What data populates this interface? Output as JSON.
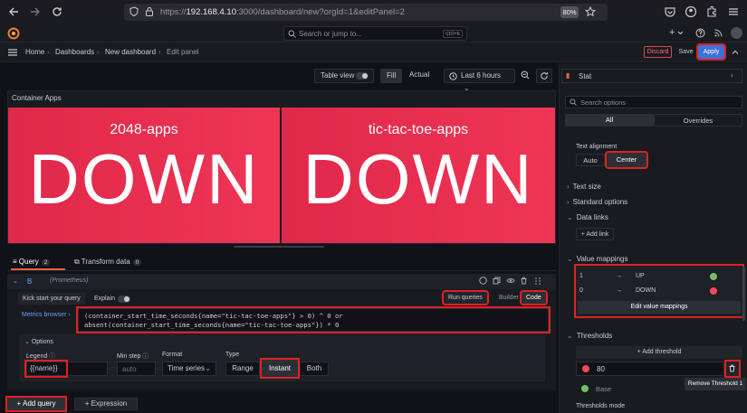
{
  "browser": {
    "url_prefix": "https://",
    "url_host": "192.168.4.10",
    "url_rest": ":3000/dashboard/new?orgId=1&editPanel=2",
    "zoom": "80%"
  },
  "topbar": {
    "search_placeholder": "Search or jump to...",
    "search_shortcut": "ctrl+k",
    "plus": "+"
  },
  "breadcrumb": {
    "items": [
      "Home",
      "Dashboards",
      "New dashboard",
      "Edit panel"
    ],
    "discard": "Discard",
    "save": "Save",
    "apply": "Apply"
  },
  "toolbar": {
    "table_view": "Table view",
    "fill": "Fill",
    "actual": "Actual",
    "time_range": "Last 6 hours"
  },
  "panel": {
    "title": "Container Apps",
    "stats": [
      {
        "name": "2048-apps",
        "value": "DOWN"
      },
      {
        "name": "tic-tac-toe-apps",
        "value": "DOWN"
      }
    ]
  },
  "query": {
    "tab_query": "Query",
    "tab_query_count": "2",
    "tab_transform": "Transform data",
    "tab_transform_count": "0",
    "ref_id": "B",
    "datasource": "(Prometheus)",
    "kick_start": "Kick start your query",
    "explain": "Explain",
    "run_queries": "Run queries",
    "builder": "Builder",
    "code": "Code",
    "metrics_browser": "Metrics browser",
    "expression": "(container_start_time_seconds{name=\"tic-tac-toe-apps\"} > 0) ^ 0 or absent(container_start_time_seconds{name=\"tic-tac-toe-apps\"}) * 0",
    "options_label": "Options",
    "legend_label": "Legend",
    "legend_value": "{{name}}",
    "min_step_label": "Min step",
    "min_step_placeholder": "auto",
    "format_label": "Format",
    "format_value": "Time series",
    "type_label": "Type",
    "type_range": "Range",
    "type_instant": "Instant",
    "type_both": "Both",
    "add_query": "Add query",
    "expression_btn": "Expression"
  },
  "options": {
    "viz_name": "Stat",
    "search_placeholder": "Search options",
    "tab_all": "All",
    "tab_overrides": "Overrides",
    "text_alignment_label": "Text alignment",
    "align_auto": "Auto",
    "align_center": "Center",
    "text_size": "Text size",
    "standard_options": "Standard options",
    "data_links": "Data links",
    "add_link": "Add link",
    "value_mappings": "Value mappings",
    "mappings": [
      {
        "value": "1",
        "arrow": "→",
        "text": "UP",
        "color": "#73bf69"
      },
      {
        "value": "0",
        "arrow": "→",
        "text": "DOWN",
        "color": "#f2495c"
      }
    ],
    "edit_value_mappings": "Edit value mappings",
    "thresholds": "Thresholds",
    "add_threshold": "Add threshold",
    "threshold_value": "80",
    "threshold_color": "#f2495c",
    "base_label": "Base",
    "base_color": "#73bf69",
    "remove_threshold_tooltip": "Remove Threshold 1",
    "thresholds_mode": "Thresholds mode"
  }
}
